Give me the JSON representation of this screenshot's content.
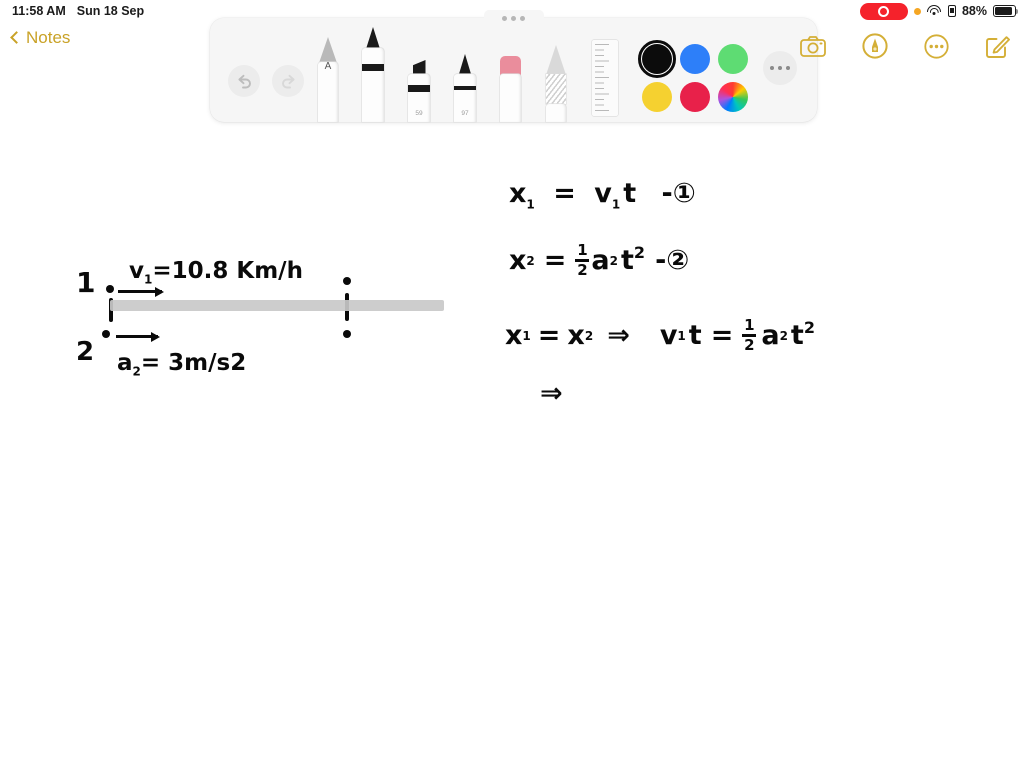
{
  "status_bar": {
    "time": "11:58 AM",
    "date": "Sun 18 Sep",
    "battery_percent": "88%",
    "icons": [
      "screen-recording-pill",
      "privacy-dot",
      "wifi-icon",
      "battery-small-icon",
      "battery-icon"
    ]
  },
  "nav": {
    "back_label": "Notes",
    "actions": [
      {
        "name": "camera-icon",
        "label": "Camera"
      },
      {
        "name": "markup-icon",
        "label": "Markup"
      },
      {
        "name": "more-icon",
        "label": "More"
      },
      {
        "name": "compose-icon",
        "label": "Compose"
      }
    ]
  },
  "toolbar": {
    "undo_label": "Undo",
    "redo_label": "Redo",
    "more_label": "More",
    "tools": [
      {
        "name": "handwriting-pen-tool",
        "label": "A"
      },
      {
        "name": "pen-tool",
        "label": ""
      },
      {
        "name": "highlighter-tool",
        "label": "59"
      },
      {
        "name": "marker-tool",
        "label": "97"
      },
      {
        "name": "eraser-tool",
        "label": ""
      },
      {
        "name": "pencil-tool",
        "label": ""
      },
      {
        "name": "ruler-tool",
        "label": ""
      }
    ],
    "colors": [
      {
        "name": "color-black",
        "hex": "#0c0c0c",
        "selected": true
      },
      {
        "name": "color-blue",
        "hex": "#2d7ff9",
        "selected": false
      },
      {
        "name": "color-green",
        "hex": "#5edc73",
        "selected": false
      },
      {
        "name": "color-yellow",
        "hex": "#f5d130",
        "selected": false
      },
      {
        "name": "color-red",
        "hex": "#e8214a",
        "selected": false
      },
      {
        "name": "color-wheel",
        "hex": "rainbow",
        "selected": false
      }
    ]
  },
  "note": {
    "diagram": {
      "label_1": "1",
      "label_2": "2",
      "velocity_text": "v",
      "velocity_sub": "1",
      "velocity_value": "=10.8 Km/h",
      "accel_text": "a",
      "accel_sub": "2",
      "accel_value": "= 3m/s2"
    },
    "equations": [
      {
        "name": "equation-1",
        "lhs": "x",
        "lhs_sub": "1",
        "eq": "=",
        "rhs": "v",
        "rhs_sub": "1",
        "rhs_rest": "t",
        "tag": "-①"
      },
      {
        "name": "equation-2",
        "lhs": "x",
        "lhs_sub": "2",
        "eq": "=",
        "frac_num": "1",
        "frac_den": "2",
        "rhs": "a",
        "rhs_sub": "2",
        "rhs_rest": "t",
        "rhs_pow": "2",
        "tag": "-②"
      },
      {
        "name": "equation-3",
        "lhs": "x",
        "lhs_sub": "1",
        "eq": "=",
        "rhs": "x",
        "rhs_sub": "2",
        "implies": "⇒",
        "right_lhs": "v",
        "right_lhs_sub": "1",
        "right_rest": "t",
        "right_eq": "=",
        "frac_num": "1",
        "frac_den": "2",
        "right_rhs": "a",
        "right_rhs_sub": "2",
        "right_rhs_rest": "t",
        "right_pow": "2"
      },
      {
        "name": "equation-4",
        "implies": "⇒"
      }
    ]
  }
}
